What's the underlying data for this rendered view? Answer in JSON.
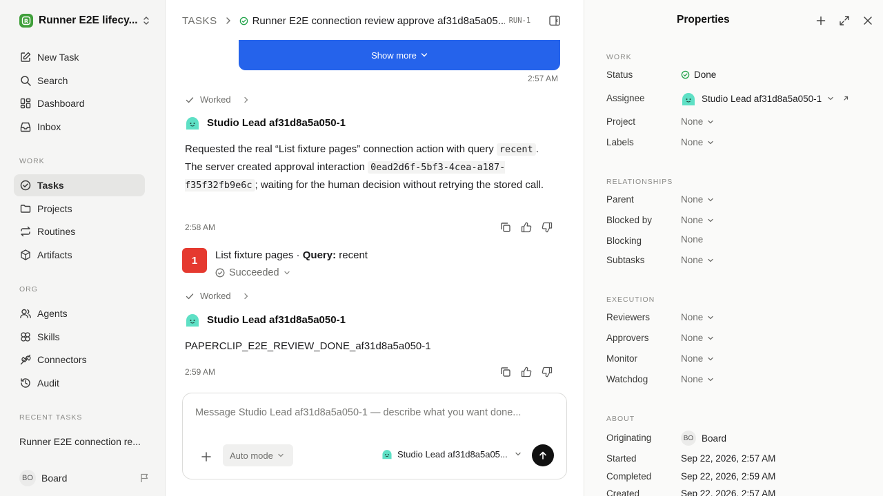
{
  "sidebar": {
    "workspace": "Runner E2E lifecy...",
    "nav": [
      {
        "label": "New Task",
        "icon": "edit-icon"
      },
      {
        "label": "Search",
        "icon": "search-icon"
      },
      {
        "label": "Dashboard",
        "icon": "dashboard-icon"
      },
      {
        "label": "Inbox",
        "icon": "inbox-icon"
      }
    ],
    "work_label": "WORK",
    "work": [
      {
        "label": "Tasks",
        "icon": "check-circle-icon",
        "active": true
      },
      {
        "label": "Projects",
        "icon": "folder-icon"
      },
      {
        "label": "Routines",
        "icon": "repeat-icon"
      },
      {
        "label": "Artifacts",
        "icon": "cube-icon"
      }
    ],
    "org_label": "ORG",
    "org": [
      {
        "label": "Agents",
        "icon": "users-icon"
      },
      {
        "label": "Skills",
        "icon": "skills-icon"
      },
      {
        "label": "Connectors",
        "icon": "plug-icon"
      },
      {
        "label": "Audit",
        "icon": "history-icon"
      }
    ],
    "recent_label": "RECENT TASKS",
    "recent_task": "Runner E2E connection re...",
    "board_initials": "BO",
    "board_name": "Board"
  },
  "header": {
    "root": "TASKS",
    "title": "Runner E2E connection review approve af31d8a5a05...",
    "run_id": "RUN-1"
  },
  "feed": {
    "show_more": "Show more",
    "time1": "2:57 AM",
    "worked1": "Worked",
    "agent1": "Studio Lead af31d8a5a050-1",
    "msg_p1": "Requested the real “List fixture pages” connection action with query ",
    "msg_code1": "recent",
    "msg_p2": ". The server created approval interaction ",
    "msg_code2": "0ead2d6f-5bf3-4cea-a187-f35f32fb9e6c",
    "msg_p3": "; waiting for the human decision without retrying the stored call.",
    "time2": "2:58 AM",
    "tool_number": "1",
    "tool_name": "List fixture pages · ",
    "tool_query_label": "Query:",
    "tool_query": " recent",
    "tool_status": "Succeeded",
    "worked2": "Worked",
    "agent2": "Studio Lead af31d8a5a050-1",
    "msg2": "PAPERCLIP_E2E_REVIEW_DONE_af31d8a5a050-1",
    "time3": "2:59 AM"
  },
  "composer": {
    "placeholder": "Message Studio Lead af31d8a5a050-1 — describe what you want done...",
    "mode": "Auto mode",
    "agent": "Studio Lead af31d8a5a05..."
  },
  "properties": {
    "title": "Properties",
    "work_label": "WORK",
    "status_label": "Status",
    "status": "Done",
    "assignee_label": "Assignee",
    "assignee": "Studio Lead af31d8a5a050-1",
    "project_label": "Project",
    "project": "None",
    "labels_label": "Labels",
    "labels": "None",
    "rel_label": "RELATIONSHIPS",
    "parent_label": "Parent",
    "parent": "None",
    "blocked_by_label": "Blocked by",
    "blocked_by": "None",
    "blocking_label": "Blocking",
    "blocking": "None",
    "subtasks_label": "Subtasks",
    "subtasks": "None",
    "exec_label": "EXECUTION",
    "reviewers_label": "Reviewers",
    "reviewers": "None",
    "approvers_label": "Approvers",
    "approvers": "None",
    "monitor_label": "Monitor",
    "monitor": "None",
    "watchdog_label": "Watchdog",
    "watchdog": "None",
    "about_label": "ABOUT",
    "originating_label": "Originating",
    "originating_initials": "BO",
    "originating": "Board",
    "started_label": "Started",
    "started": "Sep 22, 2026, 2:57 AM",
    "completed_label": "Completed",
    "completed": "Sep 22, 2026, 2:59 AM",
    "created_label": "Created",
    "created": "Sep 22, 2026, 2:57 AM"
  },
  "colors": {
    "accent": "#2563eb",
    "done": "#22a34a",
    "tool_badge": "#e5392f",
    "brand": "#3f9f3a"
  }
}
